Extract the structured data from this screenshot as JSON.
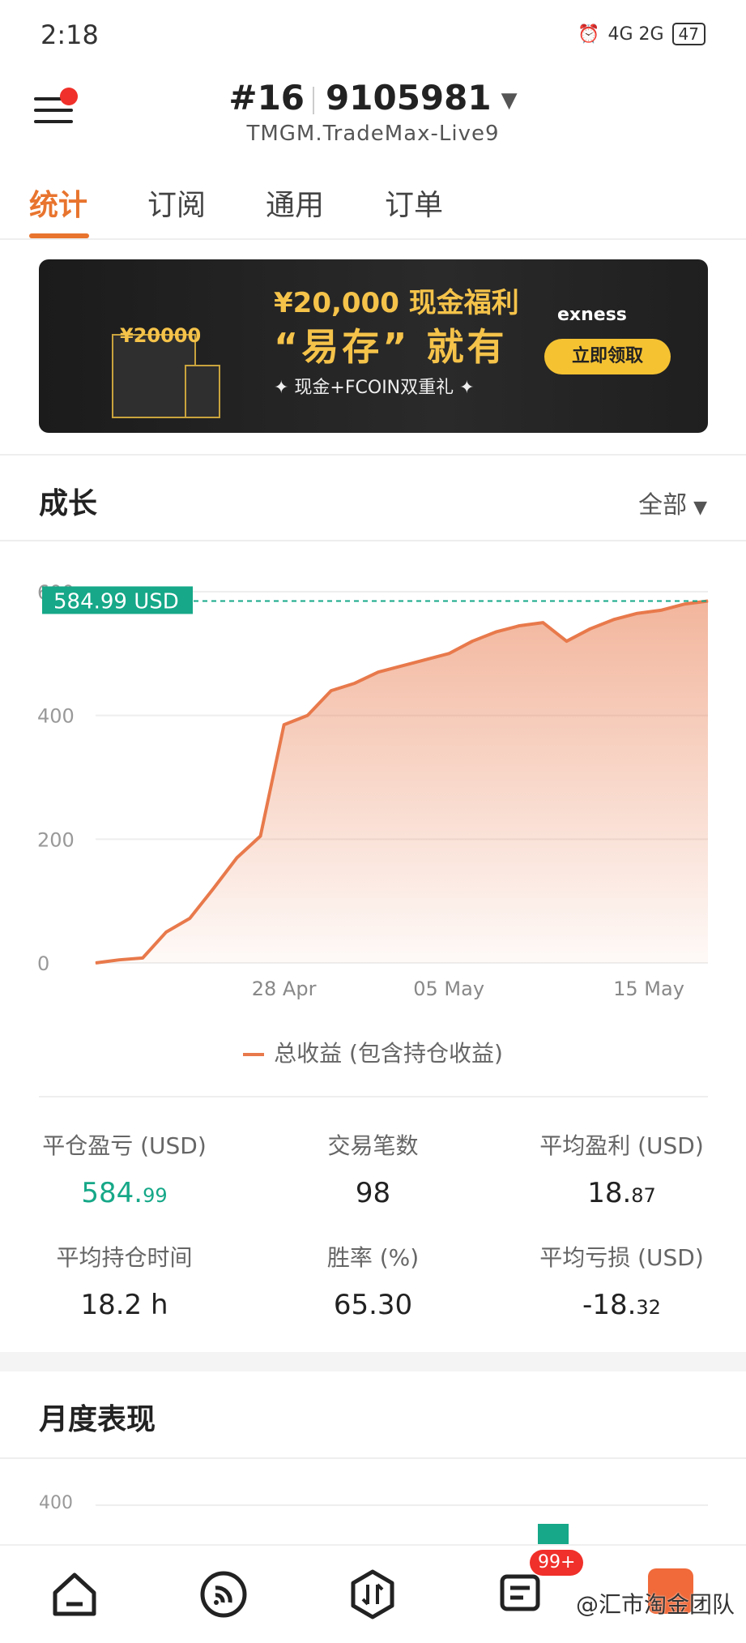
{
  "status_bar": {
    "time": "2:18",
    "network": "4G  2G",
    "battery": "47"
  },
  "header": {
    "account_prefix": "#16",
    "account_number": "9105981",
    "server": "TMGM.TradeMax-Live9"
  },
  "tabs": [
    {
      "label": "统计"
    },
    {
      "label": "订阅"
    },
    {
      "label": "通用"
    },
    {
      "label": "订单"
    }
  ],
  "banner": {
    "amount": "¥20,000 现金福利",
    "headline": "“易存” 就有",
    "subtitle": "✦ 现金+FCOIN双重礼 ✦",
    "brand": "exness",
    "cta": "立即领取",
    "gift_label": "¥20000"
  },
  "growth": {
    "title": "成长",
    "filter": "全部",
    "legend": "总收益 (包含持仓收益)"
  },
  "chart_data": {
    "type": "area",
    "x": [
      "20 Apr",
      "21 Apr",
      "22 Apr",
      "23 Apr",
      "24 Apr",
      "25 Apr",
      "26 Apr",
      "27 Apr",
      "28 Apr",
      "29 Apr",
      "30 Apr",
      "01 May",
      "02 May",
      "03 May",
      "04 May",
      "05 May",
      "06 May",
      "07 May",
      "08 May",
      "09 May",
      "10 May",
      "11 May",
      "12 May",
      "13 May",
      "14 May",
      "15 May",
      "16 May"
    ],
    "values": [
      0,
      5,
      8,
      50,
      72,
      120,
      170,
      205,
      385,
      400,
      440,
      452,
      470,
      480,
      490,
      500,
      520,
      535,
      545,
      550,
      520,
      540,
      555,
      565,
      570,
      580,
      584.99
    ],
    "x_ticks": [
      "28 Apr",
      "05 May",
      "15 May"
    ],
    "y_ticks": [
      0,
      200,
      400,
      600
    ],
    "ylim": [
      0,
      600
    ],
    "current_label": "584.99 USD",
    "current_value": 584.99,
    "color": "#e8794b",
    "label_color": "#16a888"
  },
  "stats": [
    {
      "label": "平仓盈亏 (USD)",
      "int": "584.",
      "dec": "99",
      "green": true
    },
    {
      "label": "交易笔数",
      "int": "98",
      "dec": ""
    },
    {
      "label": "平均盈利 (USD)",
      "int": "18.",
      "dec": "87"
    },
    {
      "label": "平均持仓时间",
      "int": "18.2 h",
      "dec": ""
    },
    {
      "label": "胜率 (%)",
      "int": "65.30",
      "dec": ""
    },
    {
      "label": "平均亏损 (USD)",
      "int": "-18.",
      "dec": "32"
    }
  ],
  "monthly": {
    "title": "月度表现",
    "y_tick": "400"
  },
  "bottom_nav": {
    "badge": "99+",
    "watermark": "@汇市淘金团队"
  }
}
